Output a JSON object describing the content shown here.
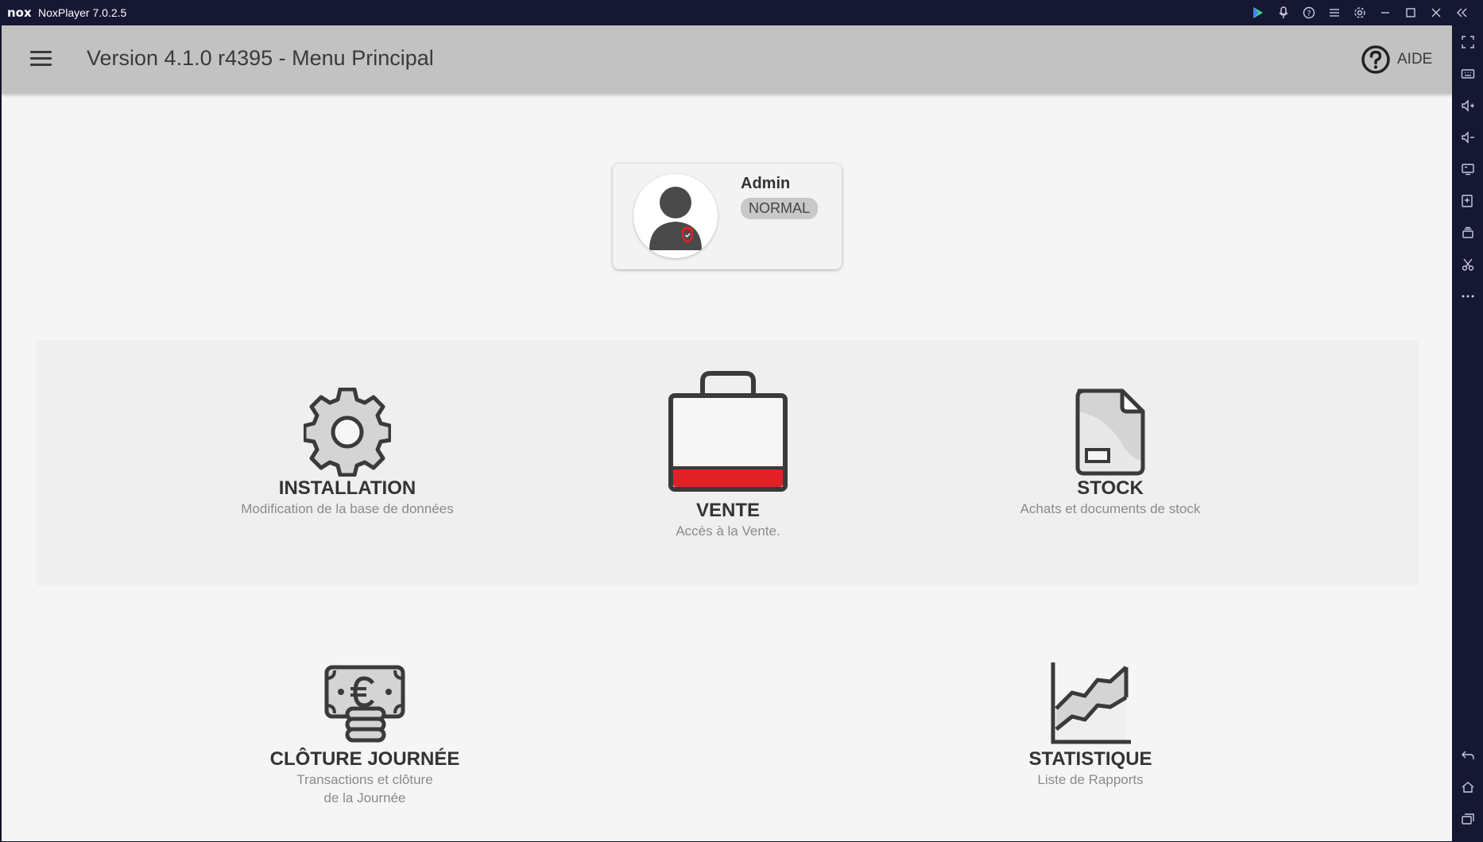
{
  "window": {
    "logo_text": "nox",
    "title": "NoxPlayer 7.0.2.5"
  },
  "app": {
    "title": "Version 4.1.0 r4395 - Menu Principal",
    "help_label": "AIDE"
  },
  "user": {
    "name": "Admin",
    "role": "NORMAL"
  },
  "menu": {
    "installation": {
      "label": "INSTALLATION",
      "desc": "Modification de la base de données"
    },
    "vente": {
      "label": "VENTE",
      "desc": "Accès à la Vente."
    },
    "stock": {
      "label": "STOCK",
      "desc": "Achats et documents de stock"
    },
    "cloture": {
      "label": "CLÔTURE JOURNÉE",
      "desc_line1": "Transactions et clôture",
      "desc_line2": "de la Journée"
    },
    "statistique": {
      "label": "STATISTIQUE",
      "desc": "Liste de Rapports"
    }
  },
  "colors": {
    "header_bg": "#c2c2c2",
    "screen_bg": "#f5f5f5",
    "accent_red": "#e02128",
    "emulator_bg": "#151733"
  }
}
